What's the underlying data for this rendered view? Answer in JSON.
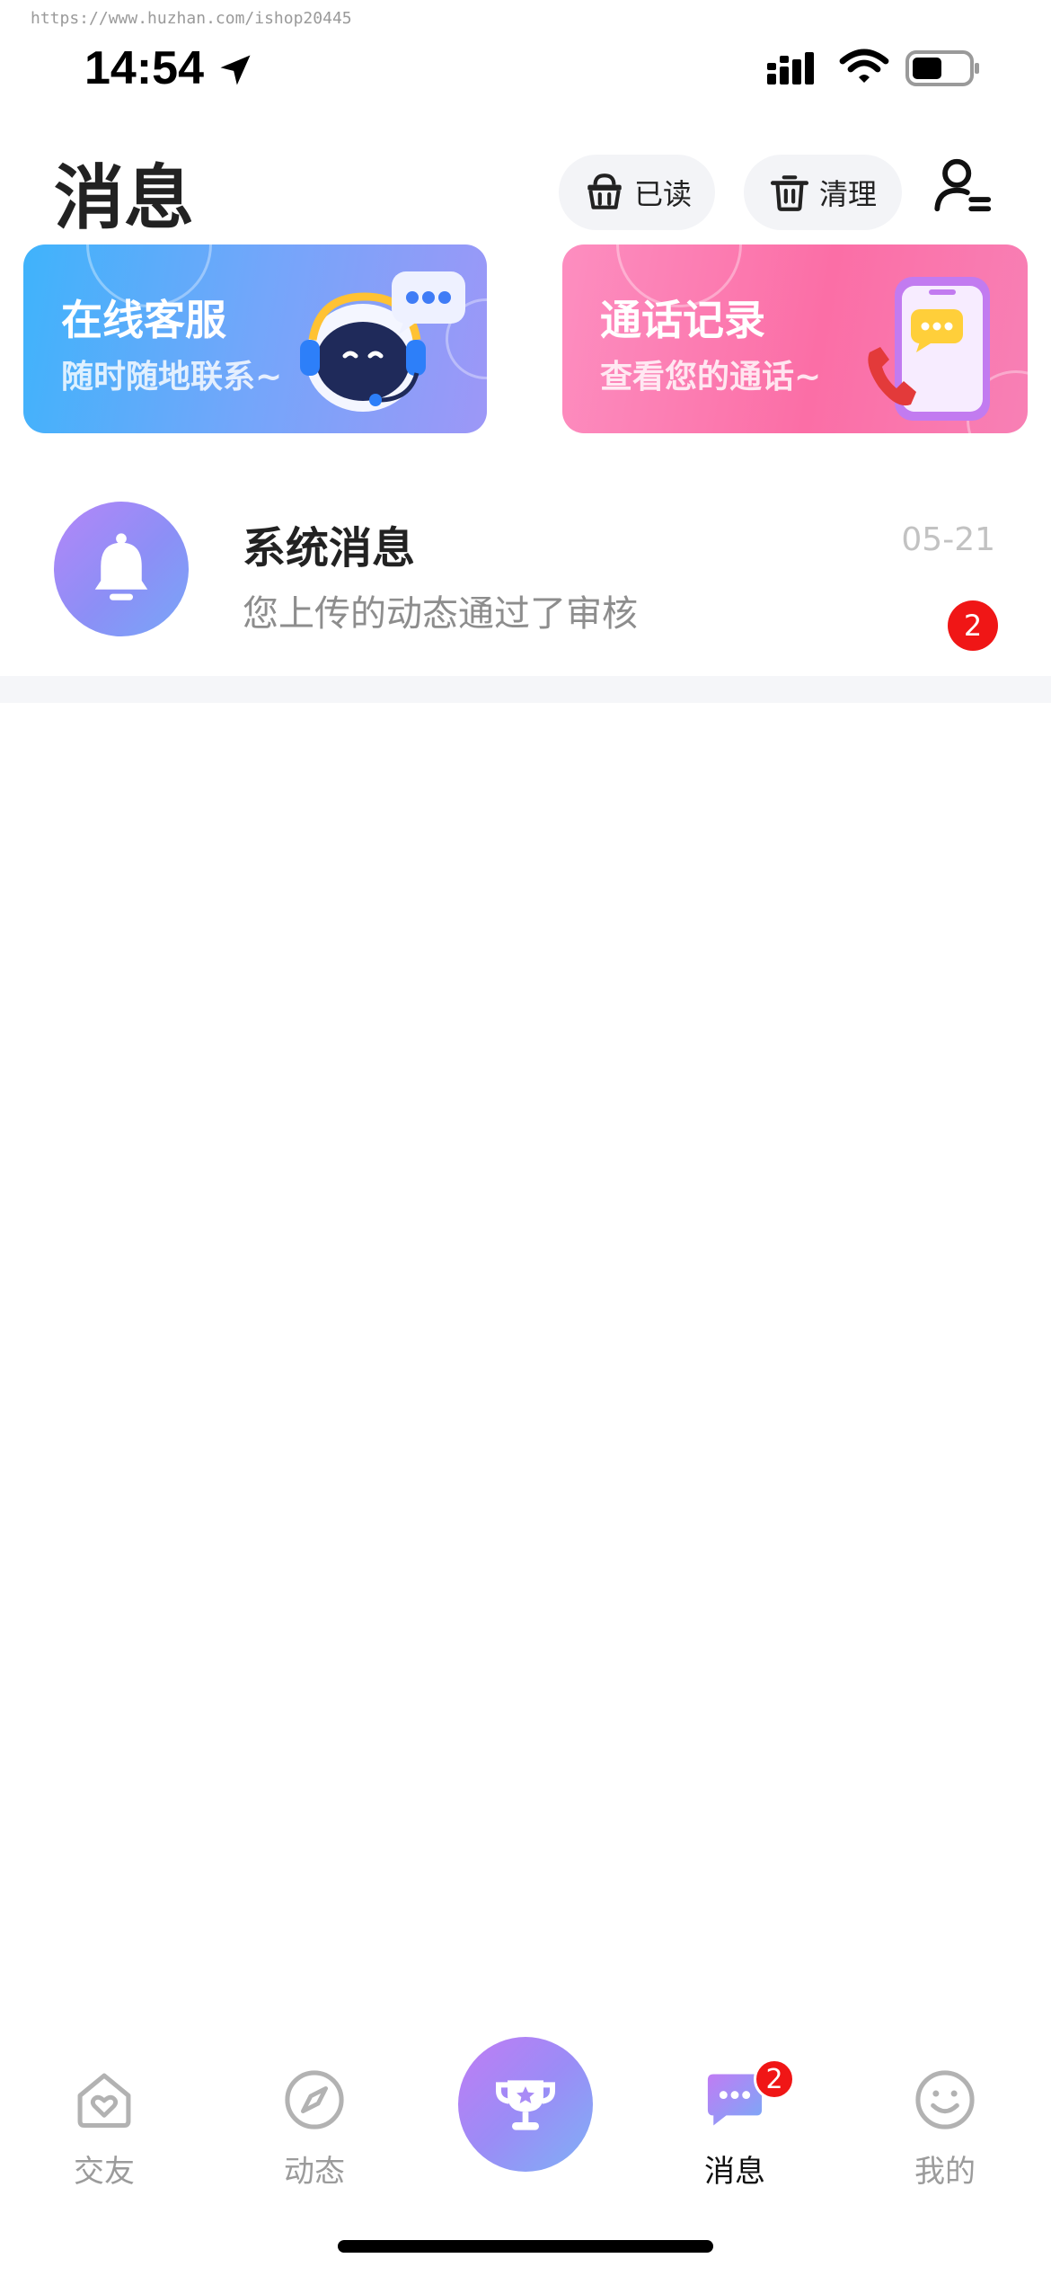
{
  "watermark": "https://www.huzhan.com/ishop20445",
  "status_bar": {
    "time": "14:54"
  },
  "header": {
    "title": "消息",
    "mark_read_label": "已读",
    "clear_label": "清理"
  },
  "banners": [
    {
      "title": "在线客服",
      "subtitle": "随时随地联系~"
    },
    {
      "title": "通话记录",
      "subtitle": "查看您的通话~"
    }
  ],
  "messages": [
    {
      "title": "系统消息",
      "preview": "您上传的动态通过了审核",
      "date": "05-21",
      "unread": "2"
    }
  ],
  "tabbar": {
    "items": [
      {
        "label": "交友",
        "icon": "home-heart-icon"
      },
      {
        "label": "动态",
        "icon": "compass-icon"
      },
      {
        "label": "消息",
        "icon": "chat-bubble-icon",
        "badge": "2",
        "active": true
      },
      {
        "label": "我的",
        "icon": "smiley-icon"
      }
    ],
    "center_icon": "trophy-icon"
  },
  "colors": {
    "badge": "#f01616",
    "accent_purple": "#9b8cf6",
    "banner_service": "#3fb3fb",
    "banner_calls": "#fb6ea6"
  }
}
